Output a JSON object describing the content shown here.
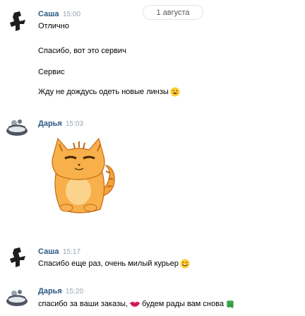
{
  "date_divider": "1 августа",
  "messages": [
    {
      "author": "Саша",
      "time": "15:00",
      "lines": [
        "Отлично",
        "Спасибо, вот это сервич",
        "Сервис",
        "Жду не дождусь одеть новые линзы"
      ],
      "emoji": [
        "laughing-face-icon"
      ]
    },
    {
      "author": "Дарья",
      "time": "15:03",
      "sticker": "orange-cat-sticker"
    },
    {
      "author": "Саша",
      "time": "15:17",
      "lines": [
        "Спасибо еще раз, очень милый курьер"
      ],
      "emoji": [
        "grinning-face-icon"
      ]
    },
    {
      "author": "Дарья",
      "time": "15:20",
      "text_before": "спасибо за ваши заказы,",
      "text_after": "будем рады вам снова",
      "emoji": [
        "kiss-lips-icon",
        "four-leaf-clover-icon"
      ]
    }
  ],
  "colors": {
    "author_name": "#2a5885",
    "time": "#9aa4ae",
    "divider_border": "#dfe3e8"
  }
}
